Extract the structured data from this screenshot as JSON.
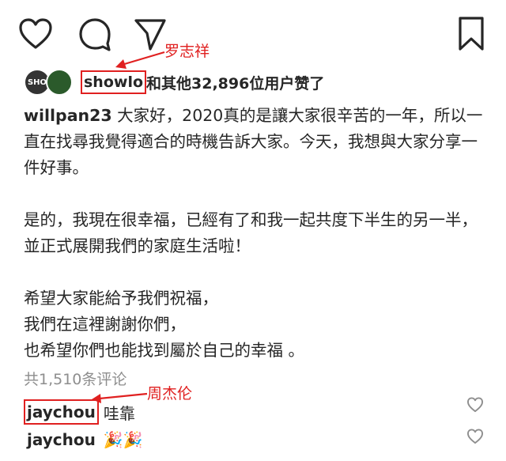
{
  "actions": {
    "like_icon": "heart-icon",
    "comment_icon": "comment-icon",
    "share_icon": "send-icon",
    "save_icon": "bookmark-icon"
  },
  "annotations": {
    "showlo_label": "罗志祥",
    "jaychou_label": "周杰伦",
    "color": "#e02020"
  },
  "likes": {
    "avatar1_text": "SHO",
    "username": "showlo",
    "text": "和其他32,896位用户赞了"
  },
  "caption": {
    "username": "willpan23",
    "paragraph1": " 大家好，2020真的是讓大家很辛苦的一年，所以一直在找尋我覺得適合的時機告訴大家。今天，我想與大家分享一件好事。",
    "paragraph2": "是的，我現在很幸福，已經有了和我一起共度下半生的另一半，並正式展開我們的家庭生活啦！",
    "paragraph3": "希望大家能給予我們祝福，\n我們在這裡謝謝你們，\n也希望你們也能找到屬於自己的幸福 。"
  },
  "comments_count": "共1,510条评论",
  "comments": [
    {
      "username": "jaychou",
      "text": "哇靠"
    },
    {
      "username": "jaychou",
      "text": "🎉🎉"
    }
  ]
}
